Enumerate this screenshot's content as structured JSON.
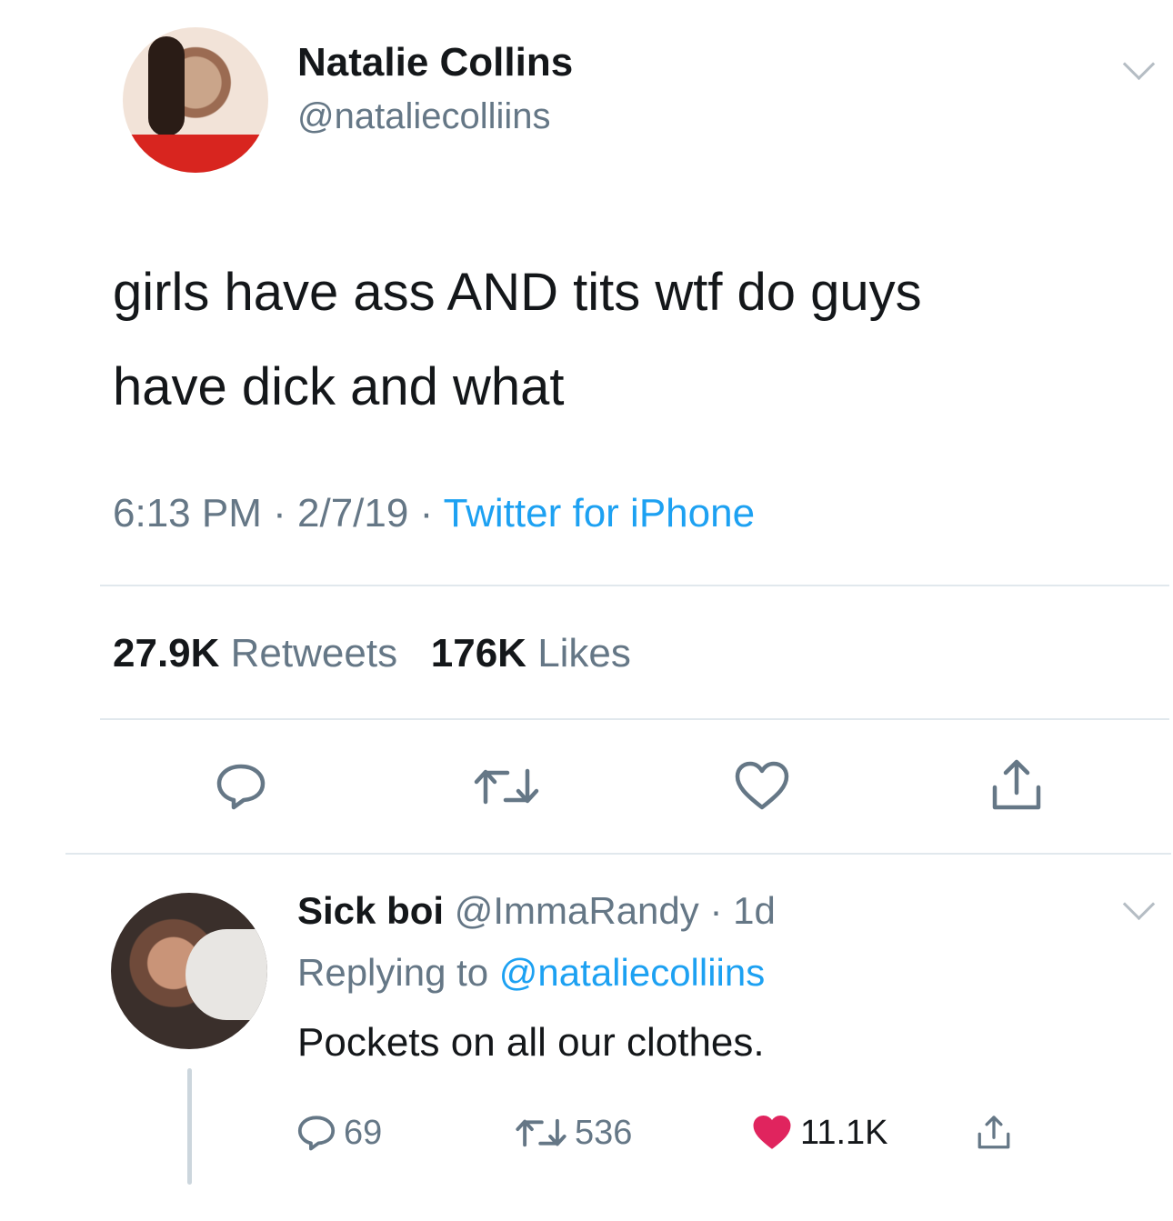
{
  "tweet": {
    "author_name": "Natalie Collins",
    "author_handle": "@nataliecolliins",
    "text_line1": "girls have ass AND tits wtf do guys",
    "text_line2": "have dick and what",
    "time": "6:13 PM",
    "date": "2/7/19",
    "source": "Twitter for iPhone",
    "retweets_count": "27.9K",
    "retweets_label": "Retweets",
    "likes_count": "176K",
    "likes_label": "Likes"
  },
  "reply": {
    "author_name": "Sick boi",
    "author_handle": "@ImmaRandy",
    "age": "1d",
    "replying_prefix": "Replying to",
    "replying_to": "@nataliecolliins",
    "text": "Pockets on all our clothes.",
    "replies": "69",
    "retweets": "536",
    "likes": "11.1K"
  },
  "colors": {
    "accent": "#1da1f2",
    "muted": "#657786",
    "like": "#e0245e",
    "divider": "#e1e8ed"
  },
  "icons": [
    "chevron-down-icon",
    "reply-icon",
    "retweet-icon",
    "heart-icon",
    "share-icon",
    "heart-filled-icon"
  ]
}
